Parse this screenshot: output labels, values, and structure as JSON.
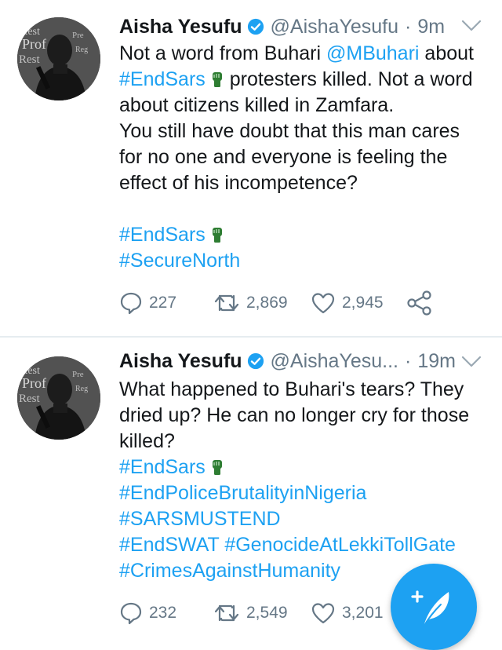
{
  "colors": {
    "link": "#1da1f2",
    "muted": "#657786",
    "text": "#14171a",
    "divider": "#e6ecf0",
    "fab": "#1da1f2"
  },
  "tweets": [
    {
      "author": {
        "name": "Aisha Yesufu",
        "handle": "@AishaYesufu",
        "verified": true
      },
      "time": "9m",
      "lines": [
        [
          {
            "t": "Not a word from Buhari "
          },
          {
            "t": "@MBuhari",
            "link": true
          },
          {
            "t": " about"
          }
        ],
        [
          {
            "t": "#EndSars",
            "link": true,
            "fist": true
          },
          {
            "t": "  protesters killed. Not a word"
          }
        ],
        [
          {
            "t": "about citizens killed in Zamfara."
          }
        ],
        [
          {
            "t": "You still have doubt that this man cares"
          }
        ],
        [
          {
            "t": "for no one and everyone is feeling the"
          }
        ],
        [
          {
            "t": "effect of his incompetence?"
          }
        ],
        [],
        [
          {
            "t": "#EndSars",
            "link": true,
            "fist": true
          }
        ],
        [
          {
            "t": "#SecureNorth",
            "link": true
          }
        ]
      ],
      "counts": {
        "replies": "227",
        "retweets": "2,869",
        "likes": "2,945"
      }
    },
    {
      "author": {
        "name": "Aisha Yesufu",
        "handle": "@AishaYesu...",
        "verified": true
      },
      "time": "19m",
      "lines": [
        [
          {
            "t": "What happened to Buhari's tears? They"
          }
        ],
        [
          {
            "t": "dried up? He can no longer cry for those"
          }
        ],
        [
          {
            "t": "killed?"
          }
        ],
        [
          {
            "t": "#EndSars",
            "link": true,
            "fist": true
          }
        ],
        [
          {
            "t": "#EndPoliceBrutalityinNigeria",
            "link": true
          }
        ],
        [
          {
            "t": "#SARSMUSTEND",
            "link": true
          }
        ],
        [
          {
            "t": "#EndSWAT",
            "link": true
          },
          {
            "t": " "
          },
          {
            "t": "#GenocideAtLekkiTollGate",
            "link": true
          }
        ],
        [
          {
            "t": "#CrimesAgainstHumanity",
            "link": true
          }
        ]
      ],
      "counts": {
        "replies": "232",
        "retweets": "2,549",
        "likes": "3,201"
      }
    }
  ],
  "icons": {
    "verified": "verified-badge-icon",
    "chevron": "chevron-down-icon",
    "reply": "reply-icon",
    "retweet": "retweet-icon",
    "like": "heart-icon",
    "share": "share-icon",
    "fist": "raised-fist-emoji-icon",
    "compose": "compose-tweet-icon"
  }
}
